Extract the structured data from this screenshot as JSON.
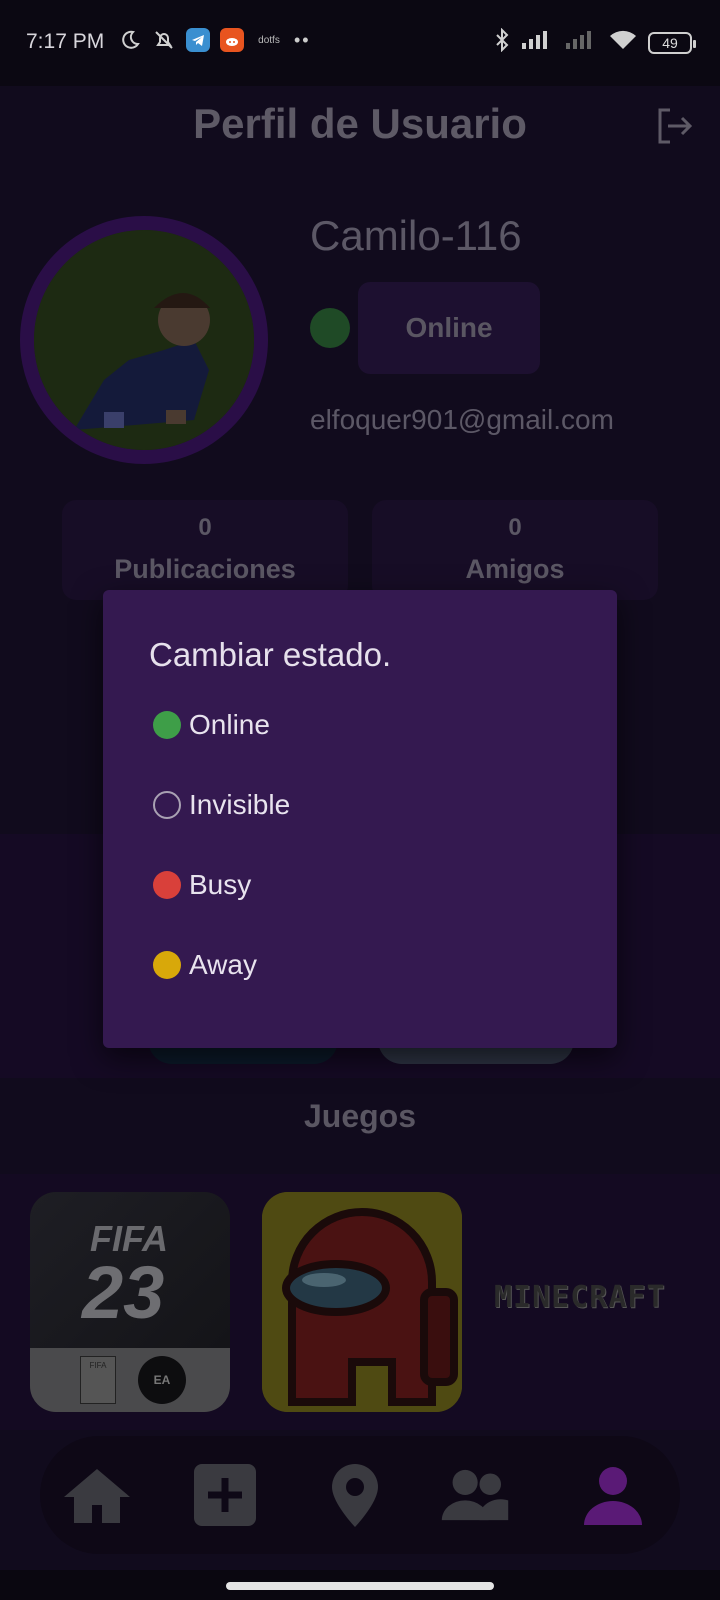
{
  "status_bar": {
    "time": "7:17 PM",
    "battery": "49",
    "notif_text": "dotfs"
  },
  "header": {
    "title": "Perfil de Usuario"
  },
  "profile": {
    "username": "Camilo-116",
    "status": "Online",
    "email": "elfoquer901@gmail.com"
  },
  "stats": [
    {
      "value": "0",
      "label": "Publicaciones"
    },
    {
      "value": "0",
      "label": "Amigos"
    }
  ],
  "games": {
    "title": "Juegos",
    "items": [
      {
        "name": "FIFA 23",
        "line1": "FIFA",
        "line2": "23",
        "badge": "EA SPORTS"
      },
      {
        "name": "Among Us"
      },
      {
        "name": "MINECRAFT"
      }
    ]
  },
  "dialog": {
    "title": "Cambiar estado.",
    "options": [
      {
        "label": "Online",
        "color": "#3e9e48"
      },
      {
        "label": "Invisible",
        "color": "transparent"
      },
      {
        "label": "Busy",
        "color": "#d9403a"
      },
      {
        "label": "Away",
        "color": "#d8a80a"
      }
    ]
  },
  "nav": [
    "home-icon",
    "add-icon",
    "location-icon",
    "friends-icon",
    "profile-icon"
  ],
  "colors": {
    "accent": "#6a1d8a",
    "dialog_bg": "#341950",
    "app_bg": "#110b1d"
  }
}
